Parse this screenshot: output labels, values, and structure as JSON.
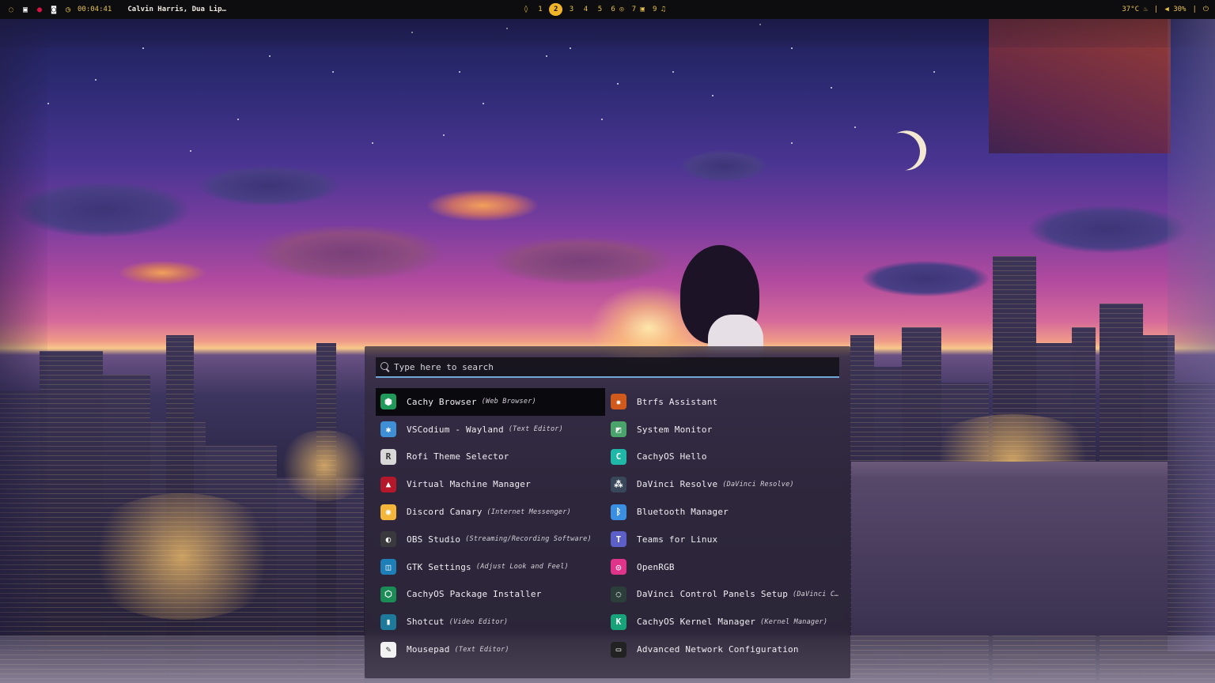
{
  "topbar": {
    "clock": "00:04:41",
    "media_title": "Calvin Harris, Dua Lip…",
    "workspaces": [
      {
        "label": "1",
        "active": false
      },
      {
        "label": "2",
        "active": true
      },
      {
        "label": "3",
        "active": false
      },
      {
        "label": "4",
        "active": false
      },
      {
        "label": "5",
        "active": false
      },
      {
        "label": "6 ◎",
        "active": false
      },
      {
        "label": "7 ▣",
        "active": false
      },
      {
        "label": "9 ♫",
        "active": false
      }
    ],
    "temperature": "37°C",
    "volume": "30%",
    "separator": "|"
  },
  "launcher": {
    "search_placeholder": "Type here to search",
    "apps": [
      {
        "name": "Cachy Browser",
        "desc": "(Web Browser)",
        "icon": "cachy-browser-icon",
        "color": "#1f9a5b",
        "glyph": "⬢",
        "selected": true
      },
      {
        "name": "Btrfs Assistant",
        "desc": "",
        "icon": "btrfs-assistant-icon",
        "color": "#d05a1c",
        "glyph": "✹",
        "selected": false
      },
      {
        "name": "VSCodium - Wayland",
        "desc": "(Text Editor)",
        "icon": "vscodium-icon",
        "color": "#3f8fd6",
        "glyph": "✱",
        "selected": false
      },
      {
        "name": "System Monitor",
        "desc": "",
        "icon": "system-monitor-icon",
        "color": "#4aa36a",
        "glyph": "◩",
        "selected": false
      },
      {
        "name": "Rofi Theme Selector",
        "desc": "",
        "icon": "rofi-theme-icon",
        "color": "#d8d8d8",
        "glyph": "R",
        "selected": false
      },
      {
        "name": "CachyOS Hello",
        "desc": "",
        "icon": "cachyos-hello-icon",
        "color": "#1fb8a8",
        "glyph": "C",
        "selected": false
      },
      {
        "name": "Virtual Machine Manager",
        "desc": "",
        "icon": "virt-manager-icon",
        "color": "#b5182a",
        "glyph": "▲",
        "selected": false
      },
      {
        "name": "DaVinci Resolve",
        "desc": "(DaVinci Resolve)",
        "icon": "davinci-resolve-icon",
        "color": "#38475a",
        "glyph": "⁂",
        "selected": false
      },
      {
        "name": "Discord Canary",
        "desc": "(Internet Messenger)",
        "icon": "discord-canary-icon",
        "color": "#f4b63a",
        "glyph": "◉",
        "selected": false
      },
      {
        "name": "Bluetooth Manager",
        "desc": "",
        "icon": "bluetooth-icon",
        "color": "#3a8fe0",
        "glyph": "ᛒ",
        "selected": false
      },
      {
        "name": "OBS Studio",
        "desc": "(Streaming/Recording Software)",
        "icon": "obs-studio-icon",
        "color": "#3a3a3e",
        "glyph": "◐",
        "selected": false
      },
      {
        "name": "Teams for Linux",
        "desc": "",
        "icon": "teams-icon",
        "color": "#5b5fc7",
        "glyph": "T",
        "selected": false
      },
      {
        "name": "GTK Settings",
        "desc": "(Adjust Look and Feel)",
        "icon": "gtk-settings-icon",
        "color": "#1e7fb8",
        "glyph": "◫",
        "selected": false
      },
      {
        "name": "OpenRGB",
        "desc": "",
        "icon": "openrgb-icon",
        "color": "#e0348a",
        "glyph": "◎",
        "selected": false
      },
      {
        "name": "CachyOS Package Installer",
        "desc": "",
        "icon": "package-installer-icon",
        "color": "#1b8c55",
        "glyph": "⬡",
        "selected": false
      },
      {
        "name": "DaVinci Control Panels Setup",
        "desc": "(DaVinci Contr…",
        "icon": "davinci-control-icon",
        "color": "#2c3e3a",
        "glyph": "◌",
        "selected": false
      },
      {
        "name": "Shotcut",
        "desc": "(Video Editor)",
        "icon": "shotcut-icon",
        "color": "#1d7a9a",
        "glyph": "▮",
        "selected": false
      },
      {
        "name": "CachyOS Kernel Manager",
        "desc": "(Kernel Manager)",
        "icon": "kernel-manager-icon",
        "color": "#17a27a",
        "glyph": "K",
        "selected": false
      },
      {
        "name": "Mousepad",
        "desc": "(Text Editor)",
        "icon": "mousepad-icon",
        "color": "#f2f2f2",
        "glyph": "✎",
        "selected": false
      },
      {
        "name": "Advanced Network Configuration",
        "desc": "",
        "icon": "network-config-icon",
        "color": "#222222",
        "glyph": "▭",
        "selected": false
      }
    ]
  },
  "colors": {
    "bar_accent": "#e6c24a",
    "active_workspace": "#f0b429",
    "search_underline": "#6fa8d8"
  }
}
